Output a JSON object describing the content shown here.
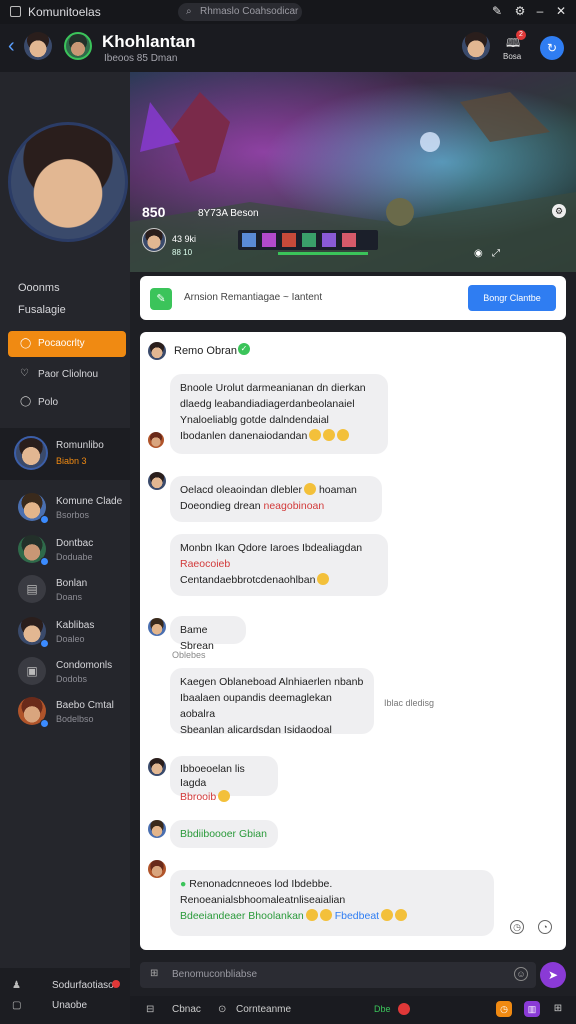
{
  "titlebar": {
    "app_name": "Komunitoelas",
    "search_placeholder": "Rhmaslo Coahsodicar"
  },
  "header": {
    "title": "Khohlantan",
    "subtitle": "Ibeoos 85 Dman",
    "right_label": "Bosa",
    "notif_count": "2"
  },
  "profile": {
    "score": "850",
    "score_sub": "8Y73A Beson",
    "level": "43 9ki",
    "level_sub": "88 10"
  },
  "sidebar": {
    "menu": [
      {
        "label": "Ooonms"
      },
      {
        "label": "Fusalagie"
      }
    ],
    "nav": [
      {
        "label": "Pocaocrlty",
        "active": true
      },
      {
        "label": "Paor Cliolnou"
      },
      {
        "label": "Polo"
      }
    ],
    "current": {
      "name": "Romunlibo",
      "status": "Biabn 3"
    },
    "friends": [
      {
        "name": "Komune Clade",
        "status": "Bsorbos"
      },
      {
        "name": "Dontbac",
        "status": "Doduabe"
      },
      {
        "name": "Bonlan",
        "status": "Doans"
      },
      {
        "name": "Kablibas",
        "status": "Doaleo"
      },
      {
        "name": "Condomonls",
        "status": "Dodobs"
      },
      {
        "name": "Baebo Cmtal",
        "status": "Bodelbso"
      }
    ],
    "footer": [
      {
        "label": "Sodurfaotiaso"
      },
      {
        "label": "Unaobe"
      }
    ]
  },
  "composer_bar": {
    "placeholder": "Arnsion  Remantiagae  ~  Iantent",
    "button": "Bongr Clantbe"
  },
  "chat": {
    "header_name": "Remo Obran",
    "messages": [
      {
        "lines": [
          "Bnoole Urolut darmeanianan dn dierkan",
          "dlaedg leabandiadiagerdanbeolanaiel",
          "Ynaloeliablg gotde dalndendaial",
          "Ibodanlen danenaiodandan"
        ]
      },
      {
        "lines": [
          "Oelacd oleaoindan dlebler",
          "hoaman",
          "Doeondieg drean",
          "neagobinoan"
        ]
      },
      {
        "lines": [
          "Monbn Ikan Qdore Iaroes Ibdealiagdan",
          "Raeocoieb",
          "Centandaebbrotcdenaohlban"
        ]
      },
      {
        "lines": [
          "Bame Sbrean"
        ]
      },
      {
        "lines": [
          "Kaegen Oblaneboad Alnhiaerlen nbanb",
          "Ibaalaen oupandis deemaglekan aobalra",
          "Sbeanlan alicardsdan Isidaodoal"
        ],
        "side_note": "Iblac dledisg"
      },
      {
        "lines": [
          "Ibboeoelan lis Iagda",
          "Bbrooib"
        ]
      },
      {
        "lines": [
          "Bbdiiboooer Gbian"
        ]
      },
      {
        "lines": [
          "Renonadcnneoes lod Ibdebbe.",
          "Renoeanialsbhoomaleatnliseaialian",
          "Bdeeiandeaer Bhoolankan",
          "Fbedbeat"
        ]
      }
    ],
    "time_label": "Oblebes"
  },
  "input": {
    "placeholder": "Benomuconbliabse"
  },
  "bottombar": {
    "left": "Cbnac",
    "mid": "Cornteanme",
    "right_badge": "Dbe"
  },
  "colors": {
    "accent": "#f08a12",
    "primary_button": "#2f7df2",
    "online": "#3bc45a",
    "send": "#8a3ad6"
  }
}
